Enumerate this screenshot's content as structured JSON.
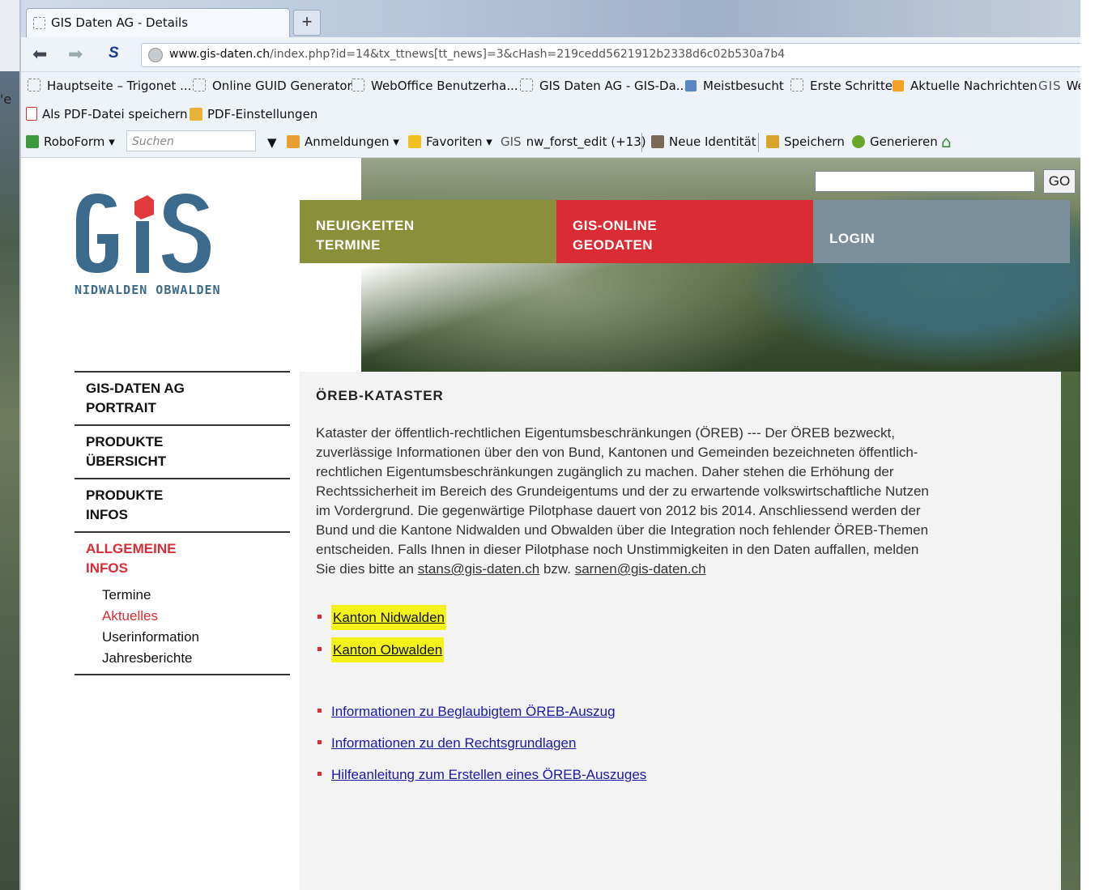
{
  "browser": {
    "tab_title": "GIS Daten AG - Details",
    "new_tab_label": "+",
    "url_domain": "www.gis-daten.ch",
    "url_path": "/index.php?id=14&tx_ttnews[tt_news]=3&cHash=219cedd5621912b2338d6c02b530a7b4",
    "bookmarks": [
      {
        "label": "Hauptseite – Trigonet ...",
        "icon": "page-icon"
      },
      {
        "label": "Online GUID Generator",
        "icon": "page-icon"
      },
      {
        "label": "WebOffice Benutzerha...",
        "icon": "page-icon"
      },
      {
        "label": "GIS Daten AG - GIS-Da...",
        "icon": "page-icon"
      },
      {
        "label": "Meistbesucht",
        "icon": "blue-folder-icon"
      },
      {
        "label": "Erste Schritte",
        "icon": "page-icon"
      },
      {
        "label": "Aktuelle Nachrichten",
        "icon": "rss-icon"
      },
      {
        "label": "We",
        "icon": "gis-icon"
      }
    ],
    "pdf_bar": {
      "save_pdf": "Als PDF-Datei speichern",
      "pdf_settings": "PDF-Einstellungen"
    },
    "roboform": {
      "roboform_label": "RoboForm",
      "search_placeholder": "Suchen",
      "logins": "Anmeldungen",
      "favorites": "Favoriten",
      "recent": "nw_forst_edit",
      "recent_count": "(+13)",
      "new_identity": "Neue Identität",
      "save": "Speichern",
      "generate": "Generieren"
    },
    "edge_glyph": "'e"
  },
  "site": {
    "go_label": "GO",
    "logo_sub": "NIDWALDEN OBWALDEN",
    "nav": [
      {
        "line1": "NEUIGKEITEN",
        "line2": "TERMINE",
        "color": "#8a8f3a"
      },
      {
        "line1": "GIS-ONLINE",
        "line2": "GEODATEN",
        "color": "#d92c35"
      },
      {
        "line1": "LOGIN",
        "line2": "",
        "color": "#7c8f9c"
      }
    ],
    "sidebar": [
      {
        "line1": "GIS-DATEN AG",
        "line2": "PORTRAIT"
      },
      {
        "line1": "PRODUKTE",
        "line2": "ÜBERSICHT"
      },
      {
        "line1": "PRODUKTE",
        "line2": "INFOS"
      },
      {
        "line1": "ALLGEMEINE",
        "line2": "INFOS"
      }
    ],
    "sub_links": [
      "Termine",
      "Aktuelles",
      "Userinformation",
      "Jahresberichte"
    ]
  },
  "content": {
    "title": "ÖREB-KATASTER",
    "paragraph": "Kataster der öffentlich-rechtlichen Eigentumsbeschränkungen (ÖREB) --- Der ÖREB bezweckt, zuverlässige Informationen über den von Bund, Kantonen und Gemeinden bezeichneten öffentlich-rechtlichen Eigentumsbeschränkungen zugänglich zu machen. Daher stehen die Erhöhung der Rechtssicherheit im Bereich des Grundeigentums und der zu erwartende volkswirtschaftliche Nutzen im Vordergrund. Die gegenwärtige Pilotphase dauert von 2012 bis 2014. Anschliessend werden der Bund und die Kantone Nidwalden und Obwalden über die Integration noch fehlender ÖREB-Themen entscheiden. Falls Ihnen in dieser Pilotphase noch Unstimmigkeiten in den Daten auffallen, melden Sie dies bitte an",
    "email1": "stans@gis-daten.ch",
    "bzw": "bzw.",
    "email2": "sarnen@gis-daten.ch",
    "links": [
      "Kanton Nidwalden",
      "Kanton Obwalden",
      "Informationen zu Beglaubigtem ÖREB-Auszug",
      "Informationen zu den Rechtsgrundlagen",
      "Hilfeanleitung zum Erstellen eines ÖREB-Auszuges"
    ]
  }
}
